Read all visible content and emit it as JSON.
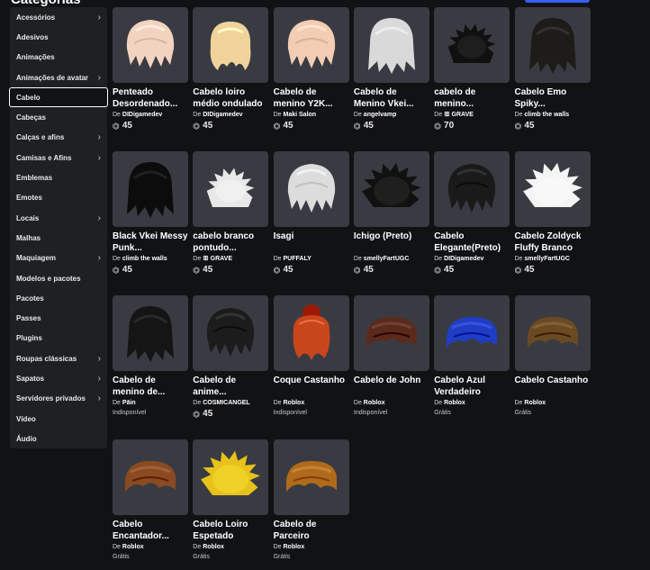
{
  "heading": "Categorias",
  "sidebar": {
    "items": [
      {
        "label": "Acessórios",
        "chevron": true
      },
      {
        "label": "Adesivos",
        "chevron": false
      },
      {
        "label": "Animações",
        "chevron": false
      },
      {
        "label": "Animações de avatar",
        "chevron": true
      },
      {
        "label": "Cabelo",
        "chevron": false,
        "active": true
      },
      {
        "label": "Cabeças",
        "chevron": false
      },
      {
        "label": "Calças e afins",
        "chevron": true
      },
      {
        "label": "Camisas e Afins",
        "chevron": true
      },
      {
        "label": "Emblemas",
        "chevron": false
      },
      {
        "label": "Emotes",
        "chevron": false
      },
      {
        "label": "Locais",
        "chevron": true
      },
      {
        "label": "Malhas",
        "chevron": false
      },
      {
        "label": "Maquiagem",
        "chevron": true
      },
      {
        "label": "Modelos e pacotes",
        "chevron": false
      },
      {
        "label": "Pacotes",
        "chevron": false
      },
      {
        "label": "Passes",
        "chevron": false
      },
      {
        "label": "Plugins",
        "chevron": false
      },
      {
        "label": "Roupas clássicas",
        "chevron": true
      },
      {
        "label": "Sapatos",
        "chevron": true
      },
      {
        "label": "Servidores privados",
        "chevron": true
      },
      {
        "label": "Vídeo",
        "chevron": false
      },
      {
        "label": "Áudio",
        "chevron": false
      }
    ]
  },
  "creator_prefix": "De",
  "robux_icon": "robux-icon",
  "items": [
    {
      "name": "Penteado Desordenado...",
      "creator": "DIDigamedev",
      "price": "45",
      "color": "#f2d3c0",
      "style": "messy"
    },
    {
      "name": "Cabelo loiro médio ondulado",
      "creator": "DIDigamedev",
      "price": "45",
      "color": "#f0d39a",
      "style": "wavy"
    },
    {
      "name": "Cabelo de menino Y2K...",
      "creator": "Maki Salon",
      "price": "45",
      "color": "#f3cdb3",
      "style": "messy"
    },
    {
      "name": "Cabelo de Menino Vkei...",
      "creator": "angelvamp",
      "price": "45",
      "color": "#d9d9d9",
      "style": "long"
    },
    {
      "name": "cabelo de menino...",
      "creator": "ꕥ GRAVE",
      "price": "70",
      "color": "#101010",
      "style": "spiky-small"
    },
    {
      "name": "Cabelo Emo Spiky...",
      "creator": "climb the walls",
      "price": "45",
      "color": "#1e1c18",
      "style": "long"
    },
    {
      "name": "Black Vkei Messy Punk...",
      "creator": "climb the walls",
      "price": "45",
      "color": "#0c0c0c",
      "style": "long"
    },
    {
      "name": "cabelo branco pontudo...",
      "creator": "ꕥ GRAVE",
      "price": "45",
      "color": "#e8e8e8",
      "style": "spiky-small"
    },
    {
      "name": "Isagi",
      "creator": "PUFFALY",
      "price": "45",
      "color": "#dcdcdc",
      "style": "messy"
    },
    {
      "name": "Ichigo (Preto)",
      "creator": "smellyFartUGC",
      "price": "45",
      "color": "#111111",
      "style": "spiky"
    },
    {
      "name": "Cabelo Elegante(Preto)",
      "creator": "DIDigamedev",
      "price": "45",
      "color": "#1a1a1a",
      "style": "messy"
    },
    {
      "name": "Cabelo Zoldyck Fluffy Branco",
      "creator": "smellyFartUGC",
      "price": "45",
      "color": "#f4f4f4",
      "style": "spiky"
    },
    {
      "name": "Cabelo de menino de...",
      "creator": "Pāin",
      "status": "Indisponível",
      "color": "#151515",
      "style": "long"
    },
    {
      "name": "Cabelo de anime...",
      "creator": "COSMICANGEL",
      "price": "45",
      "color": "#1c1c1c",
      "style": "messy"
    },
    {
      "name": "Coque Castanho",
      "creator": "Roblox",
      "status": "Indisponível",
      "color": "#c8461c",
      "style": "bun"
    },
    {
      "name": "Cabelo de John",
      "creator": "Roblox",
      "status": "Indisponível",
      "color": "#5a2a1c",
      "style": "flat"
    },
    {
      "name": "Cabelo Azul Verdadeiro",
      "creator": "Roblox",
      "status": "Grátis",
      "color": "#1f3ec4",
      "style": "flat"
    },
    {
      "name": "Cabelo Castanho",
      "creator": "Roblox",
      "status": "Grátis",
      "color": "#6a4a22",
      "style": "flat"
    },
    {
      "name": "Cabelo Encantador...",
      "creator": "Roblox",
      "status": "Grátis",
      "color": "#8a4a22",
      "style": "flat"
    },
    {
      "name": "Cabelo Loiro Espetado",
      "creator": "Roblox",
      "status": "Grátis",
      "color": "#e6c21a",
      "style": "spiky"
    },
    {
      "name": "Cabelo de Parceiro",
      "creator": "Roblox",
      "status": "Grátis",
      "color": "#b06a1c",
      "style": "flat"
    }
  ]
}
